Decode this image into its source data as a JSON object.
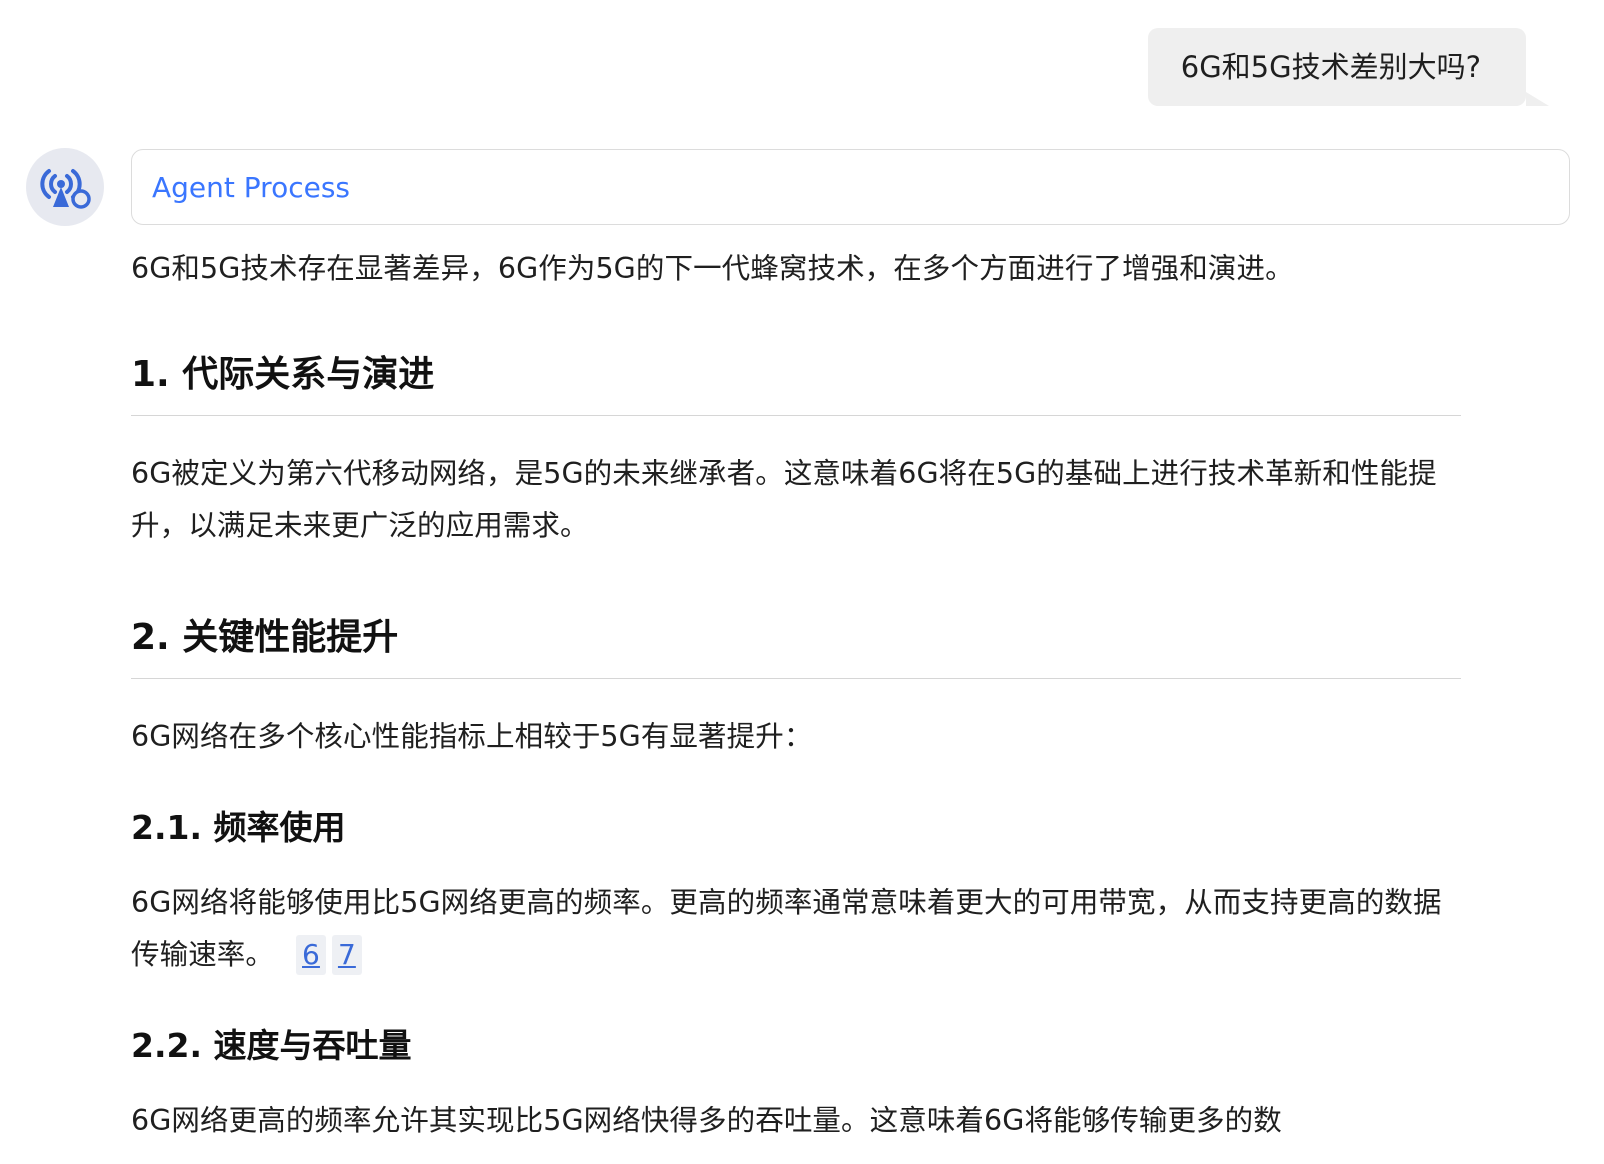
{
  "user_message": {
    "text": "6G和5G技术差别大吗?"
  },
  "agent_process": {
    "label": "Agent Process"
  },
  "answer": {
    "intro": "6G和5G技术存在显著差异，6G作为5G的下一代蜂窝技术，在多个方面进行了增强和演进。",
    "sections": [
      {
        "heading": "1. 代际关系与演进",
        "paragraph": "6G被定义为第六代移动网络，是5G的未来继承者。这意味着6G将在5G的基础上进行技术革新和性能提升，以满足未来更广泛的应用需求。"
      },
      {
        "heading": "2. 关键性能提升",
        "paragraph": "6G网络在多个核心性能指标上相较于5G有显著提升：",
        "subsections": [
          {
            "heading": "2.1. 频率使用",
            "paragraph": "6G网络将能够使用比5G网络更高的频率。更高的频率通常意味着更大的可用带宽，从而支持更高的数据传输速率。",
            "citations": [
              "6",
              "7"
            ]
          },
          {
            "heading": "2.2. 速度与吞吐量",
            "paragraph": "6G网络更高的频率允许其实现比5G网络快得多的吞吐量。这意味着6G将能够传输更多的数"
          }
        ]
      }
    ]
  },
  "colors": {
    "accent": "#3a76ff",
    "bubble_bg": "#efefef",
    "avatar_bg": "#e7e9f0",
    "citation_bg": "#eef0f4"
  },
  "icons": {
    "avatar": "signal-tower-icon"
  }
}
